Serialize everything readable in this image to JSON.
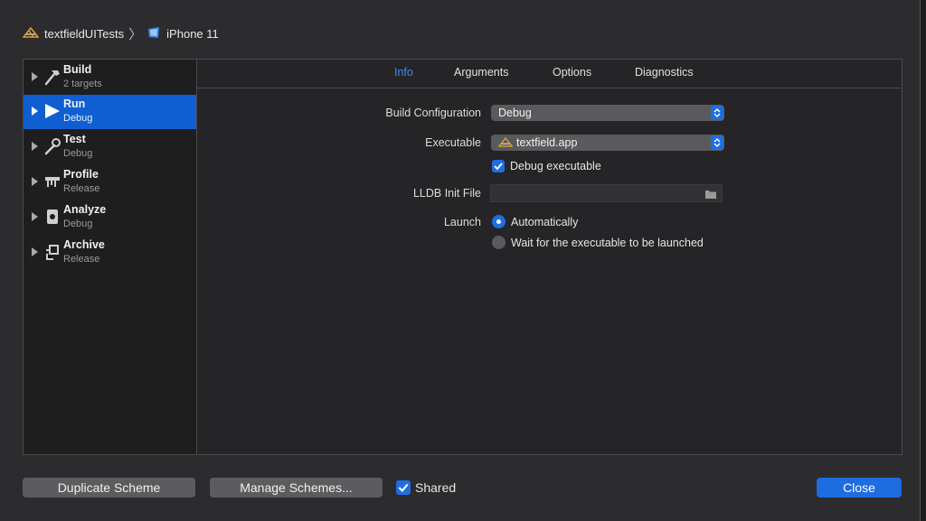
{
  "breadcrumb": {
    "target_name": "textfieldUITests",
    "target_icon": "app-target-icon",
    "separator": "〉",
    "device_name": "iPhone 11",
    "device_icon": "iphone-icon"
  },
  "sidebar": {
    "items": [
      {
        "name": "Build",
        "sub": "2 targets",
        "icon": "hammer-icon"
      },
      {
        "name": "Run",
        "sub": "Debug",
        "icon": "play-icon",
        "selected": true
      },
      {
        "name": "Test",
        "sub": "Debug",
        "icon": "wrench-icon"
      },
      {
        "name": "Profile",
        "sub": "Release",
        "icon": "instruments-icon"
      },
      {
        "name": "Analyze",
        "sub": "Debug",
        "icon": "analyze-icon"
      },
      {
        "name": "Archive",
        "sub": "Release",
        "icon": "archive-icon"
      }
    ]
  },
  "tabs": [
    {
      "label": "Info",
      "active": true
    },
    {
      "label": "Arguments"
    },
    {
      "label": "Options"
    },
    {
      "label": "Diagnostics"
    }
  ],
  "form": {
    "build_config_label": "Build Configuration",
    "build_config_value": "Debug",
    "executable_label": "Executable",
    "executable_value": "textfield.app",
    "debug_exec_label": "Debug executable",
    "debug_exec_checked": true,
    "lldb_label": "LLDB Init File",
    "lldb_value": "",
    "launch_label": "Launch",
    "launch_options": [
      {
        "label": "Automatically",
        "selected": true
      },
      {
        "label": "Wait for the executable to be launched",
        "selected": false
      }
    ]
  },
  "footer": {
    "duplicate_label": "Duplicate Scheme",
    "manage_label": "Manage Schemes...",
    "shared_label": "Shared",
    "shared_checked": true,
    "close_label": "Close"
  },
  "colors": {
    "accent": "#1d6ce0",
    "tab_active": "#3b8cf5",
    "selection": "#0f5fd2"
  }
}
